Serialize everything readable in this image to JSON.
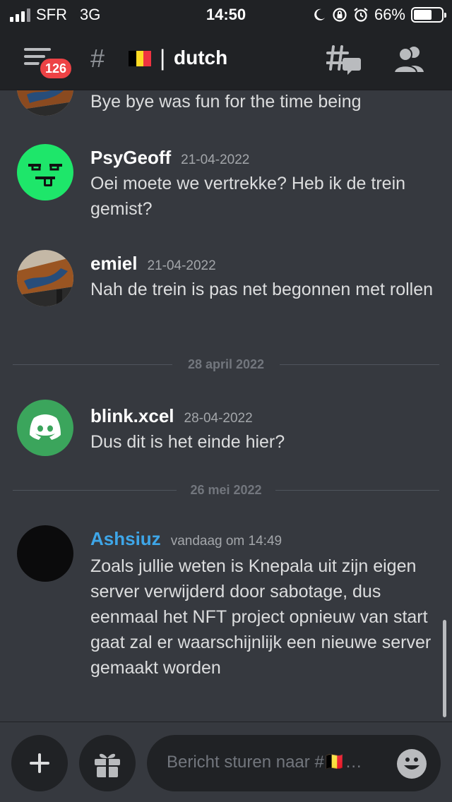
{
  "status_bar": {
    "carrier": "SFR",
    "network": "3G",
    "time": "14:50",
    "battery": "66%",
    "battery_level": 0.66,
    "signal_bars": 3
  },
  "header": {
    "notification_count": "126",
    "channel_prefix": "#",
    "channel_separator": "|",
    "channel_name": "dutch"
  },
  "messages": [
    {
      "author": "",
      "timestamp": "",
      "text": "Bye bye was fun for the time being",
      "avatar": "table-photo-avatar"
    },
    {
      "author": "PsyGeoff",
      "timestamp": "21-04-2022",
      "text": "Oei moete we vertrekke? Heb ik de trein gemist?",
      "avatar": "green-face-avatar"
    },
    {
      "author": "emiel",
      "timestamp": "21-04-2022",
      "text": "Nah de trein is pas net begonnen met rollen",
      "avatar": "table-photo-avatar"
    },
    {
      "author": "blink.xcel",
      "timestamp": "28-04-2022",
      "text": "Dus dit is het einde hier?",
      "avatar": "discord-logo-avatar"
    },
    {
      "author": "Ashsiuz",
      "timestamp": "vandaag om 14:49",
      "text": "Zoals jullie weten is Knepala uit zijn eigen server verwijderd door sabotage, dus eenmaal het NFT project opnieuw van start gaat zal er waarschijnlijk een nieuwe server gemaakt worden",
      "avatar": "black-avatar"
    }
  ],
  "dividers": [
    "28 april 2022",
    "26 mei 2022"
  ],
  "composer": {
    "placeholder": "Bericht sturen naar #🇧🇪…"
  },
  "colors": {
    "background": "#36393f",
    "header": "#202225",
    "badge": "#ed4245",
    "username_highlight": "#3ea6e8",
    "discord_green": "#3ba55c",
    "psygeoff_green": "#1ee66a"
  }
}
